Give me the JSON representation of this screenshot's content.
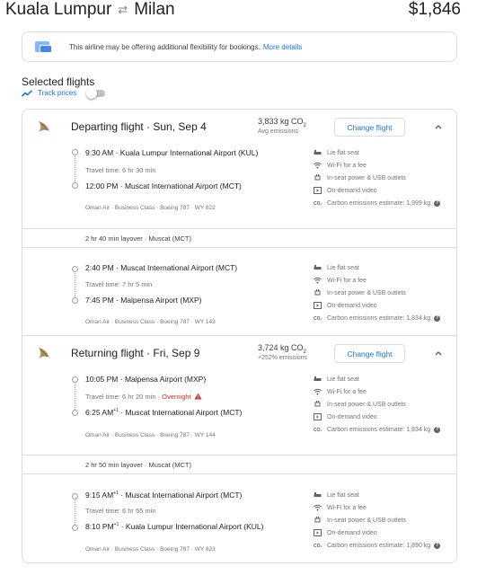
{
  "header": {
    "origin": "Kuala Lumpur",
    "destination": "Milan",
    "price": "$1,846"
  },
  "banner": {
    "text": "This airline may be offering additional flexibility for bookings.",
    "link": "More details"
  },
  "selected": {
    "title": "Selected flights",
    "track_label": "Track prices",
    "track_on": false
  },
  "departing": {
    "label": "Departing flight · Sun, Sep 4",
    "co2": "3,833 kg CO",
    "co2_sub": "2",
    "co2_note": "Avg emissions",
    "change": "Change flight",
    "segments": [
      {
        "dep_time": "9:30 AM",
        "dep_airport": "Kuala Lumpur International Airport (KUL)",
        "travel": "Travel time: 6 hr 30 min",
        "arr_time": "12:00 PM",
        "arr_sup": "",
        "arr_airport": "Muscat International Airport (MCT)",
        "meta": "Oman Air · Business Class · Boeing 787 · WY 822",
        "amenities": [
          "Lie flat seat",
          "Wi-Fi for a fee",
          "In-seat power & USB outlets",
          "On-demand video",
          "Carbon emissions estimate: 1,999 kg"
        ]
      },
      {
        "dep_time": "2:40 PM",
        "dep_airport": "Muscat International Airport (MCT)",
        "travel": "Travel time: 7 hr 5 min",
        "arr_time": "7:45 PM",
        "arr_sup": "",
        "arr_airport": "Malpensa Airport (MXP)",
        "meta": "Oman Air · Business Class · Boeing 787 · WY 143",
        "amenities": [
          "Lie flat seat",
          "Wi-Fi for a fee",
          "In-seat power & USB outlets",
          "On-demand video",
          "Carbon emissions estimate: 1,834 kg"
        ]
      }
    ],
    "layover": "2 hr 40 min layover · Muscat (MCT)"
  },
  "returning": {
    "label": "Returning flight · Fri, Sep 9",
    "co2": "3,724 kg CO",
    "co2_sub": "2",
    "co2_note": "+252% emissions",
    "change": "Change flight",
    "segments": [
      {
        "dep_time": "10:05 PM",
        "dep_sup": "",
        "dep_airport": "Malpensa Airport (MXP)",
        "travel": "Travel time: 6 hr 20 min",
        "overnight": "Overnight",
        "arr_time": "6:25 AM",
        "arr_sup": "+1",
        "arr_airport": "Muscat International Airport (MCT)",
        "meta": "Oman Air · Business Class · Boeing 787 · WY 144",
        "amenities": [
          "Lie flat seat",
          "Wi-Fi for a fee",
          "In-seat power & USB outlets",
          "On-demand video",
          "Carbon emissions estimate: 1,834 kg"
        ]
      },
      {
        "dep_time": "9:15 AM",
        "dep_sup": "+1",
        "dep_airport": "Muscat International Airport (MCT)",
        "travel": "Travel time: 6 hr 55 min",
        "arr_time": "8:10 PM",
        "arr_sup": "+1",
        "arr_airport": "Kuala Lumpur International Airport (KUL)",
        "meta": "Oman Air · Business Class · Boeing 787 · WY 823",
        "amenities": [
          "Lie flat seat",
          "Wi-Fi for a fee",
          "In-seat power & USB outlets",
          "On-demand video",
          "Carbon emissions estimate: 1,890 kg"
        ]
      }
    ],
    "layover": "2 hr 50 min layover · Muscat (MCT)"
  },
  "icons": {
    "swap": "swap-arrows-icon",
    "banner": "tickets-icon",
    "track": "trend-icon",
    "logo": "oman-air-logo",
    "chevron": "chevron-up-icon",
    "warning": "warning-icon",
    "amenities": [
      "seat-icon",
      "wifi-icon",
      "power-icon",
      "video-icon",
      "co2-icon"
    ]
  },
  "colors": {
    "accent": "#1a73e8",
    "warning": "#d93025",
    "border": "#dadce0"
  }
}
